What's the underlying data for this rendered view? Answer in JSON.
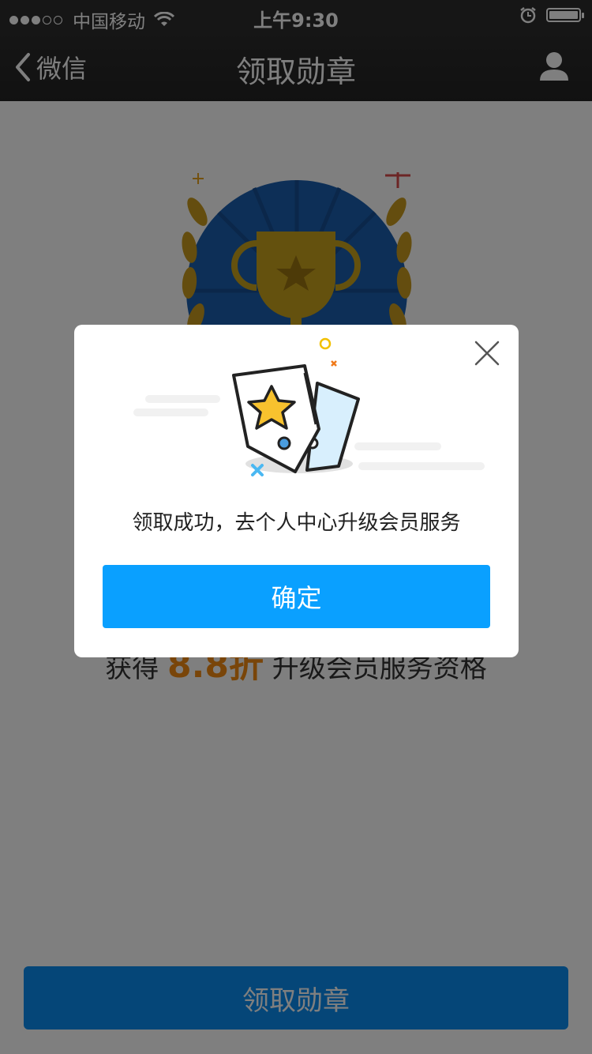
{
  "status_bar": {
    "carrier": "中国移动",
    "time": "上午9:30",
    "signal_strength": 3,
    "signal_max": 5,
    "battery_level": 1.0
  },
  "nav": {
    "back_label": "微信",
    "title": "领取勋章"
  },
  "page": {
    "promo_prefix": "获得",
    "promo_highlight": "8.8折",
    "promo_suffix": "升级会员服务资格",
    "claim_button": "领取勋章"
  },
  "dialog": {
    "message": "领取成功，去个人中心升级会员服务",
    "confirm_button": "确定"
  },
  "colors": {
    "accent": "#0aa0ff",
    "bottom_button": "#0a8cf0",
    "highlight": "#f28b12",
    "medal_blue": "#1b5fae",
    "medal_gold": "#c99a1e"
  },
  "icons": [
    "back-chevron-icon",
    "user-icon",
    "wifi-icon",
    "alarm-icon",
    "battery-icon",
    "close-icon",
    "star-badge-icon",
    "trophy-icon"
  ]
}
